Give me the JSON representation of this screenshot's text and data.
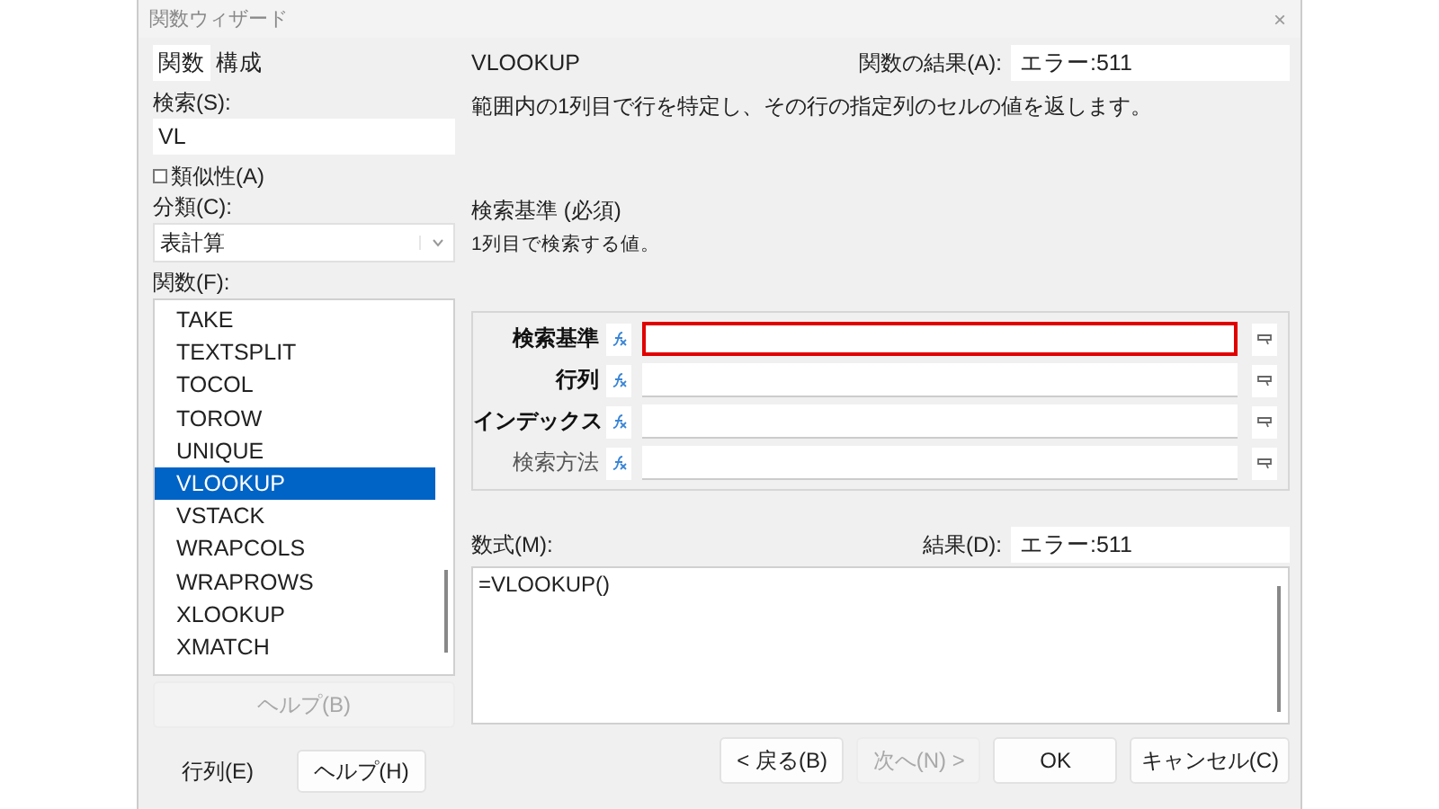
{
  "window": {
    "title": "関数ウィザード",
    "close": "×"
  },
  "tabs": [
    {
      "label": "関数",
      "selected": true
    },
    {
      "label": "構成",
      "selected": false
    }
  ],
  "search": {
    "label": "検索(S):",
    "value": "VL"
  },
  "similarity": {
    "label": "類似性(A)",
    "checked": false
  },
  "category": {
    "label": "分類(C):",
    "value": "表計算"
  },
  "functions": {
    "label": "関数(F):",
    "items": [
      {
        "name": "TAKE",
        "selected": false
      },
      {
        "name": "TEXTSPLIT",
        "selected": false
      },
      {
        "name": "TOCOL",
        "selected": false
      },
      {
        "name": "TOROW",
        "selected": false
      },
      {
        "name": "UNIQUE",
        "selected": false
      },
      {
        "name": "VLOOKUP",
        "selected": true
      },
      {
        "name": "VSTACK",
        "selected": false
      },
      {
        "name": "WRAPCOLS",
        "selected": false
      },
      {
        "name": "WRAPROWS",
        "selected": false
      },
      {
        "name": "XLOOKUP",
        "selected": false
      },
      {
        "name": "XMATCH",
        "selected": false
      }
    ]
  },
  "left_help_button": {
    "label": "ヘルプ(B)",
    "disabled": true
  },
  "left_buttons": [
    {
      "label": "行列(E)",
      "disabled": false
    },
    {
      "label": "ヘルプ(H)",
      "disabled": false
    }
  ],
  "function_name": "VLOOKUP",
  "function_result": {
    "label": "関数の結果(A):",
    "value": "エラー:511"
  },
  "description": "範囲内の1列目で行を特定し、その行の指定列のセルの値を返します。",
  "argument_title": "検索基準 (必須)",
  "argument_description": "1列目で検索する値。",
  "arguments": [
    {
      "label": "検索基準",
      "required": true,
      "highlighted": true
    },
    {
      "label": "行列",
      "required": true,
      "highlighted": false
    },
    {
      "label": "インデックス",
      "required": true,
      "highlighted": false
    },
    {
      "label": "検索方法",
      "required": false,
      "highlighted": false
    }
  ],
  "formula": {
    "label": "数式(M):",
    "value": "=VLOOKUP()"
  },
  "result": {
    "label": "結果(D):",
    "value": "エラー:511"
  },
  "buttons": [
    {
      "label": "< 戻る(B)",
      "disabled": false
    },
    {
      "label": "次へ(N) >",
      "disabled": true
    },
    {
      "label": "OK",
      "disabled": false
    },
    {
      "label": "キャンセル(C)",
      "disabled": false
    }
  ]
}
